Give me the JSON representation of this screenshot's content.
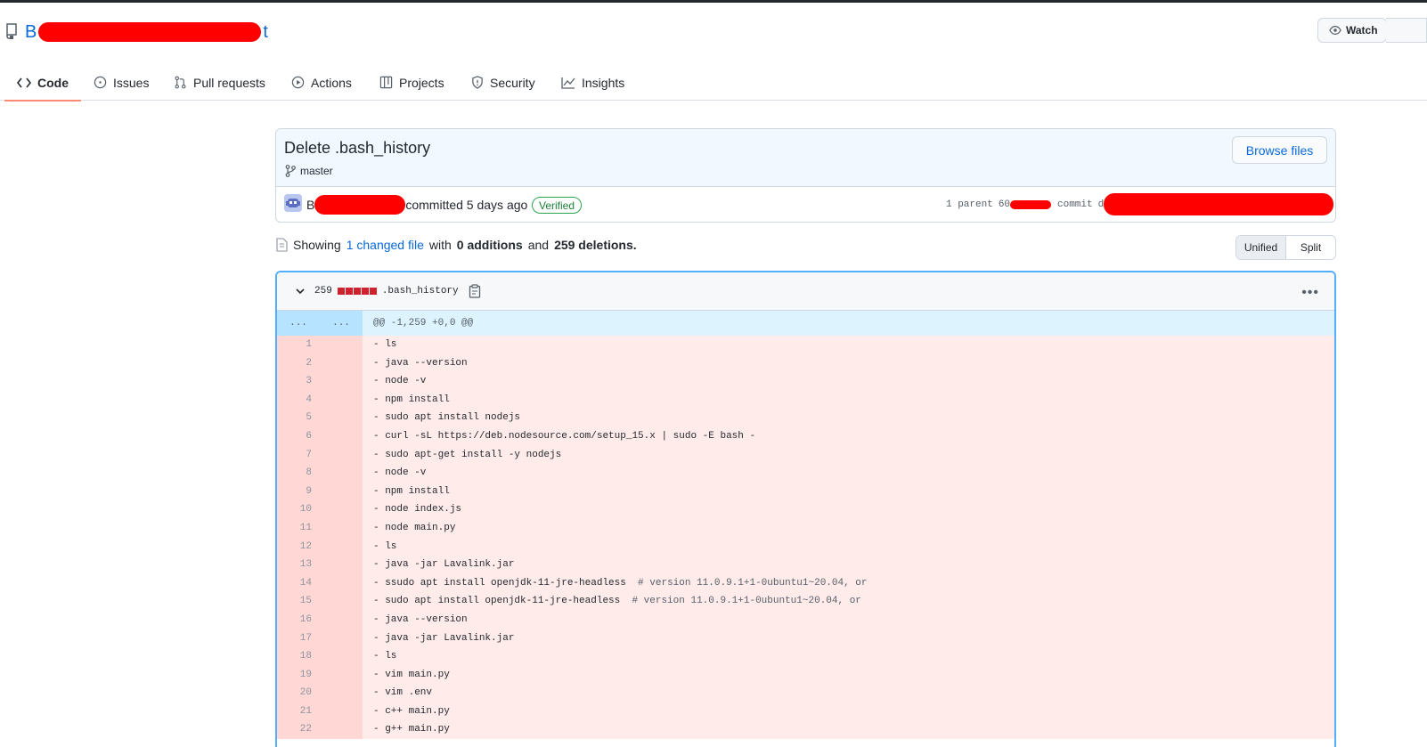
{
  "repo": {
    "name_prefix": "B",
    "name_suffix": "t",
    "watch_label": "Watch"
  },
  "tabs": [
    {
      "label": "Code",
      "icon": "code-icon"
    },
    {
      "label": "Issues",
      "icon": "issue-icon"
    },
    {
      "label": "Pull requests",
      "icon": "pull-request-icon"
    },
    {
      "label": "Actions",
      "icon": "play-icon"
    },
    {
      "label": "Projects",
      "icon": "table-icon"
    },
    {
      "label": "Security",
      "icon": "shield-icon"
    },
    {
      "label": "Insights",
      "icon": "graph-icon"
    }
  ],
  "commit": {
    "title": "Delete .bash_history",
    "branch": "master",
    "browse_label": "Browse files",
    "author_prefix": "B",
    "committed_text": "committed 5 days ago",
    "verified_label": "Verified",
    "parent_label": "1 parent",
    "parent_sha_prefix": "60",
    "commit_label": "commit",
    "commit_sha_prefix": "d"
  },
  "summary": {
    "showing": "Showing",
    "changed_link": "1 changed file",
    "with": "with",
    "additions": "0 additions",
    "and": "and",
    "deletions": "259 deletions."
  },
  "view_toggle": {
    "unified": "Unified",
    "split": "Split"
  },
  "file": {
    "change_count": "259",
    "name": ".bash_history",
    "hunk_left": "...",
    "hunk_right": "...",
    "hunk_header": "@@ -1,259 +0,0 @@",
    "lines": [
      {
        "n": "1",
        "code": "- ls"
      },
      {
        "n": "2",
        "code": "- java --version"
      },
      {
        "n": "3",
        "code": "- node -v"
      },
      {
        "n": "4",
        "code": "- npm install"
      },
      {
        "n": "5",
        "code": "- sudo apt install nodejs"
      },
      {
        "n": "6",
        "code": "- curl -sL https://deb.nodesource.com/setup_15.x | sudo -E bash -"
      },
      {
        "n": "7",
        "code": "- sudo apt-get install -y nodejs"
      },
      {
        "n": "8",
        "code": "- node -v"
      },
      {
        "n": "9",
        "code": "- npm install"
      },
      {
        "n": "10",
        "code": "- node index.js"
      },
      {
        "n": "11",
        "code": "- node main.py"
      },
      {
        "n": "12",
        "code": "- ls"
      },
      {
        "n": "13",
        "code": "- java -jar Lavalink.jar"
      },
      {
        "n": "14",
        "code": "- ssudo apt install openjdk-11-jre-headless",
        "comment": "  # version 11.0.9.1+1-0ubuntu1~20.04, or"
      },
      {
        "n": "15",
        "code": "- sudo apt install openjdk-11-jre-headless",
        "comment": "  # version 11.0.9.1+1-0ubuntu1~20.04, or"
      },
      {
        "n": "16",
        "code": "- java --version"
      },
      {
        "n": "17",
        "code": "- java -jar Lavalink.jar"
      },
      {
        "n": "18",
        "code": "- ls"
      },
      {
        "n": "19",
        "code": "- vim main.py"
      },
      {
        "n": "20",
        "code": "- vim .env"
      },
      {
        "n": "21",
        "code": "- c++ main.py"
      },
      {
        "n": "22",
        "code": "- g++ main.py"
      }
    ]
  }
}
